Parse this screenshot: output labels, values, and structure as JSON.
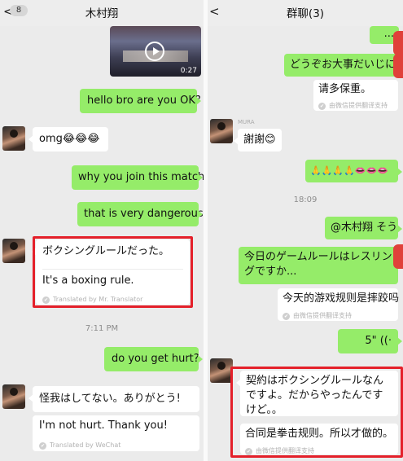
{
  "left": {
    "header": {
      "back_glyph": "<",
      "unread": "8",
      "title": "木村翔"
    },
    "video": {
      "duration": "0:27"
    },
    "messages": {
      "m1": "hello bro are you OK?",
      "m2": "omg😂😂😂",
      "m3": "why you join this match",
      "m4": "that is very dangerous",
      "m5": "ボクシングルールだった。",
      "m5_translation": "It's a boxing rule.",
      "m5_translated_by": "Translated by Mr. Translator",
      "time": "7:11 PM",
      "m6": "do you get hurt?",
      "m7": "怪我はしてない。ありがとう!",
      "m7_translation": "I'm not hurt. Thank you!",
      "m7_translated_by": "Translated by WeChat"
    }
  },
  "right": {
    "header": {
      "back_glyph": "<",
      "title": "群聊(3)"
    },
    "messages": {
      "dots": "...",
      "r1": "どうぞお大事だいじに",
      "r1_translation": "请多保重。",
      "r1_translated_by": "由微信提供翻译支持",
      "sender_name": "MURA",
      "r2": "謝謝😊",
      "r3": "🙏🙏🙏🙏👄👄👄",
      "time": "18:09",
      "r4": "@木村翔 そう",
      "r5": "今日のゲームルールはレスリングですか...",
      "r5_translation": "今天的游戏规则是摔跤吗",
      "r5_translated_by": "由微信提供翻译支持",
      "r6": "5\" ((·",
      "r7": "契約はボクシングルールなんですよ。だからやったんですけど。。",
      "r7_translation": "合同是拳击规则。所以才做的。",
      "r7_translated_by": "由微信提供翻译支持"
    }
  }
}
